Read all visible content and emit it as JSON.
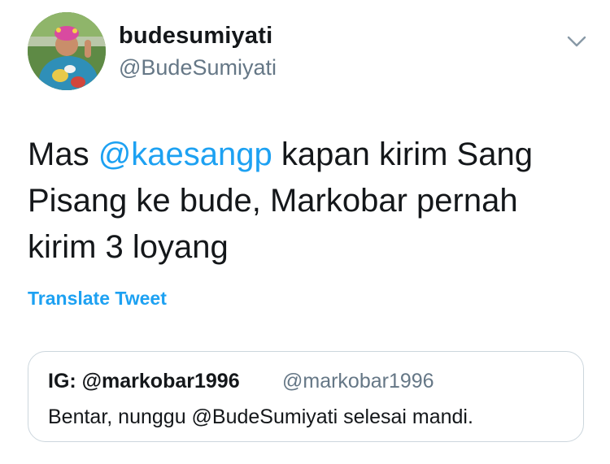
{
  "tweet": {
    "author": {
      "display_name": "budesumiyati",
      "handle": "@BudeSumiyati"
    },
    "text": {
      "before_mention": "Mas ",
      "mention": "@kaesangp",
      "after_mention": " kapan kirim Sang Pisang ke bude, Markobar pernah kirim 3 loyang"
    },
    "translate_label": "Translate Tweet",
    "quoted": {
      "display_name": "IG: @markobar1996",
      "handle": "@markobar1996",
      "text": "Bentar, nunggu @BudeSumiyati selesai mandi."
    }
  },
  "colors": {
    "link": "#1da1f2",
    "text": "#14171a",
    "secondary": "#657786",
    "border": "#ccd6dd"
  },
  "icons": {
    "menu": "chevron-down-icon"
  }
}
